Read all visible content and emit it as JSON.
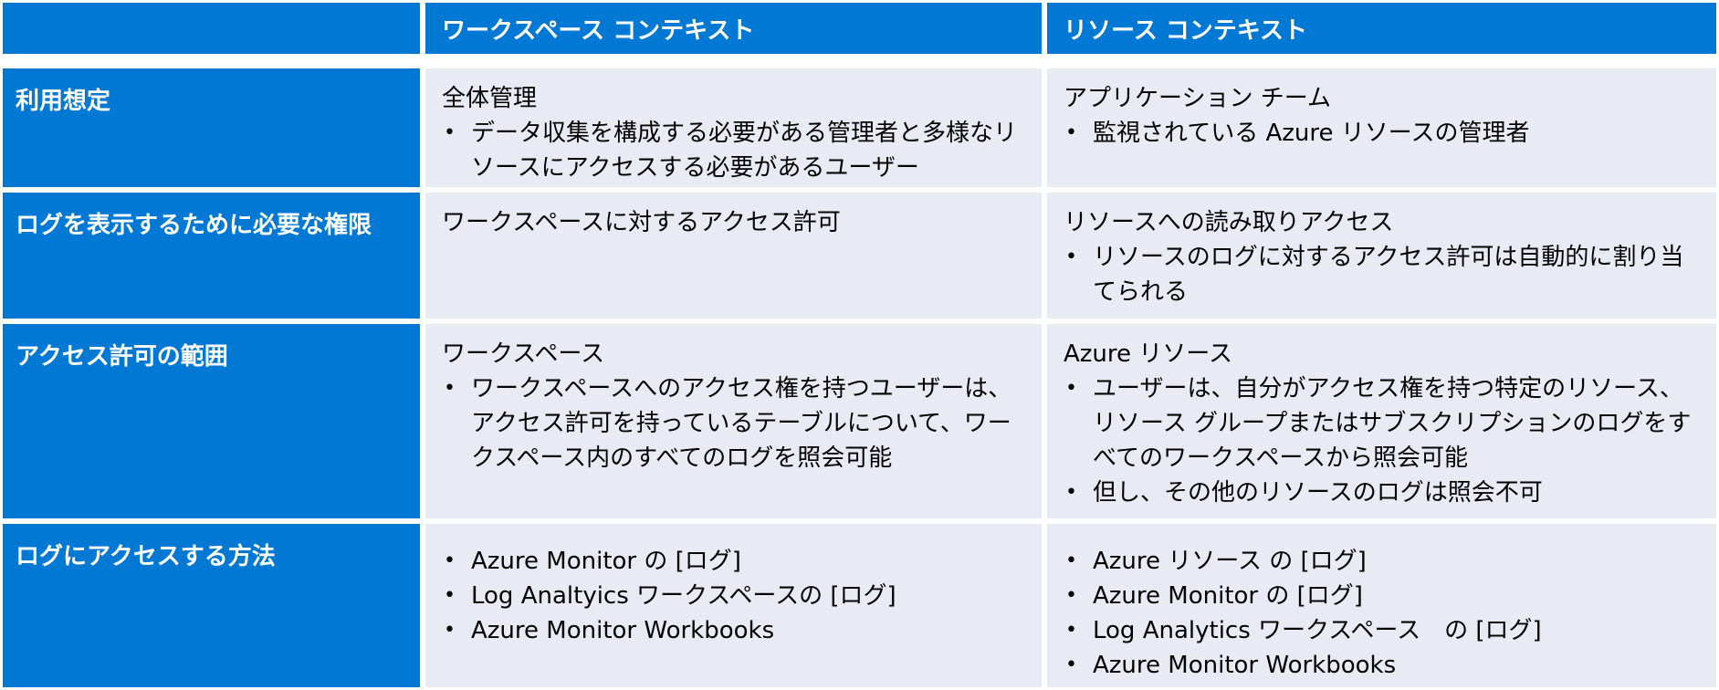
{
  "header": {
    "col1": "",
    "col2": "ワークスペース コンテキスト",
    "col3": "リソース コンテキスト"
  },
  "rows": [
    {
      "label": "利用想定",
      "workspace": {
        "title": "全体管理",
        "bullets": [
          "データ収集を構成する必要がある管理者と多様なリソースにアクセスする必要があるユーザー"
        ]
      },
      "resource": {
        "title": "アプリケーション チーム",
        "bullets": [
          "監視されている Azure リソースの管理者"
        ]
      }
    },
    {
      "label": "ログを表示するために必要な権限",
      "workspace": {
        "title": "ワークスペースに対するアクセス許可",
        "bullets": []
      },
      "resource": {
        "title": "リソースへの読み取りアクセス",
        "bullets": [
          "リソースのログに対するアクセス許可は自動的に割り当てられる"
        ]
      }
    },
    {
      "label": "アクセス許可の範囲",
      "workspace": {
        "title": "ワークスペース",
        "bullets": [
          "ワークスペースへのアクセス権を持つユーザーは、アクセス許可を持っているテーブルについて、ワークスペース内のすべてのログを照会可能"
        ]
      },
      "resource": {
        "title": "Azure リソース",
        "bullets": [
          "ユーザーは、自分がアクセス権を持つ特定のリソース、リソース グループまたはサブスクリプションのログをすべてのワークスペースから照会可能",
          "但し、その他のリソースのログは照会不可"
        ]
      }
    },
    {
      "label": "ログにアクセスする方法",
      "workspace": {
        "title": "",
        "bullets": [
          "Azure Monitor の [ログ]",
          "Log Analtyics ワークスペースの [ログ]",
          "Azure Monitor Workbooks"
        ]
      },
      "resource": {
        "title": "",
        "bullets": [
          "Azure リソース の [ログ]",
          "Azure Monitor の [ログ]",
          "Log Analytics ワークスペース　の [ログ]",
          "Azure Monitor Workbooks"
        ]
      }
    }
  ]
}
